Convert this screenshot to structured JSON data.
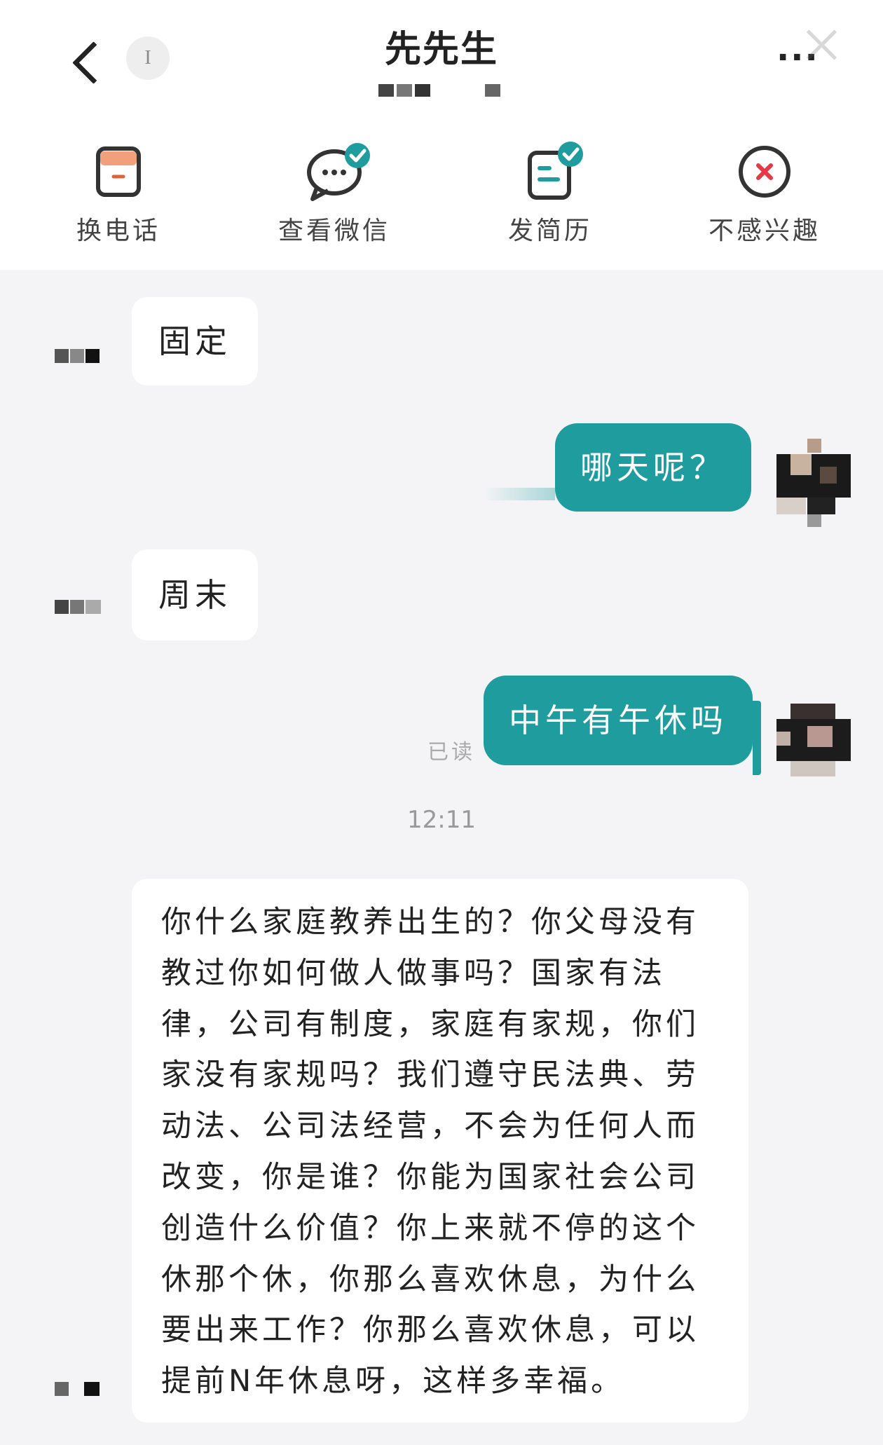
{
  "header": {
    "title": "先先生",
    "badge": "I",
    "more": "···"
  },
  "actions": [
    {
      "label": "换电话",
      "icon": "phone-card-icon"
    },
    {
      "label": "查看微信",
      "icon": "wechat-icon"
    },
    {
      "label": "发简历",
      "icon": "resume-icon"
    },
    {
      "label": "不感兴趣",
      "icon": "not-interested-icon"
    }
  ],
  "messages": [
    {
      "side": "in",
      "text": "固定"
    },
    {
      "side": "out",
      "text": "哪天呢？"
    },
    {
      "side": "in",
      "text": "周末"
    },
    {
      "side": "out",
      "text": "中午有午休吗",
      "status": "已读"
    }
  ],
  "timestamp": "12:11",
  "long_message": "你什么家庭教养出生的？你父母没有教过你如何做人做事吗？国家有法律，公司有制度，家庭有家规，你们家没有家规吗？我们遵守民法典、劳动法、公司法经营，不会为任何人而改变，你是谁？你能为国家社会公司创造什么价值？你上来就不停的这个休那个休，你那么喜欢休息，为什么要出来工作？你那么喜欢休息，可以提前N年休息呀，这样多幸福。",
  "colors": {
    "accent": "#1e9c9e",
    "danger": "#e53946",
    "check": "#1e9c9e"
  }
}
